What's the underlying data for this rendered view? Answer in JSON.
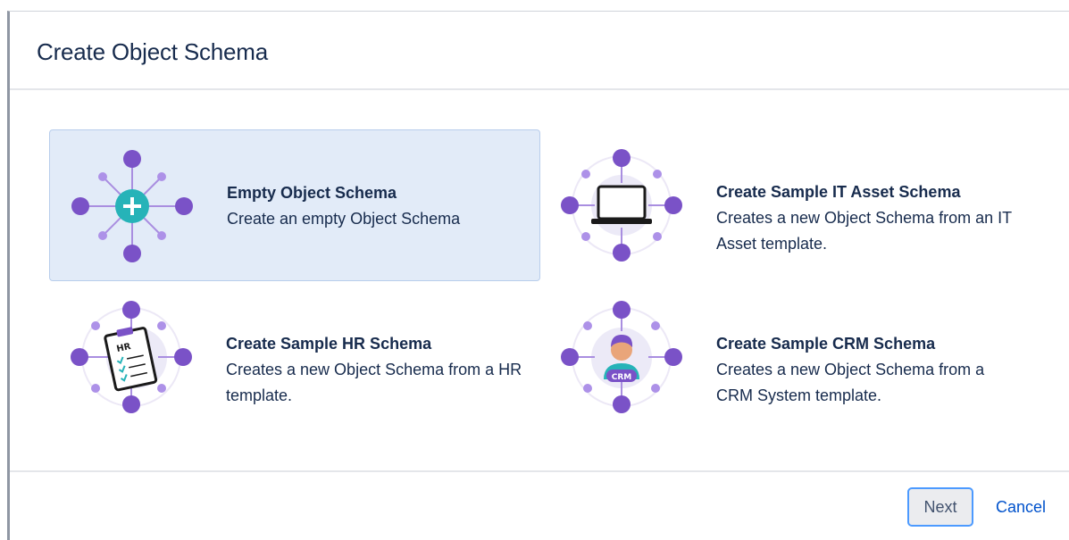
{
  "dialog": {
    "title": "Create Object Schema"
  },
  "options": [
    {
      "label": "Empty Object Schema",
      "description": "Create an empty Object Schema",
      "icon": "empty-schema-icon",
      "selected": true
    },
    {
      "label": "Create Sample IT Asset Schema",
      "description": "Creates a new Object Schema from an IT Asset template.",
      "icon": "laptop-icon",
      "selected": false
    },
    {
      "label": "Create Sample HR Schema",
      "description": "Creates a new Object Schema from a HR template.",
      "icon": "clipboard-hr-icon",
      "icon_text": "HR",
      "selected": false
    },
    {
      "label": "Create Sample CRM Schema",
      "description": "Creates a new Object Schema from a CRM System template.",
      "icon": "crm-person-icon",
      "icon_text": "CRM",
      "selected": false
    }
  ],
  "footer": {
    "next_label": "Next",
    "cancel_label": "Cancel"
  },
  "colors": {
    "node_purple": "#7a52c7",
    "accent_teal": "#26b3b8",
    "selected_bg": "#e2ebf8",
    "link_blue": "#0052cc",
    "focus_blue": "#4c9aff"
  }
}
